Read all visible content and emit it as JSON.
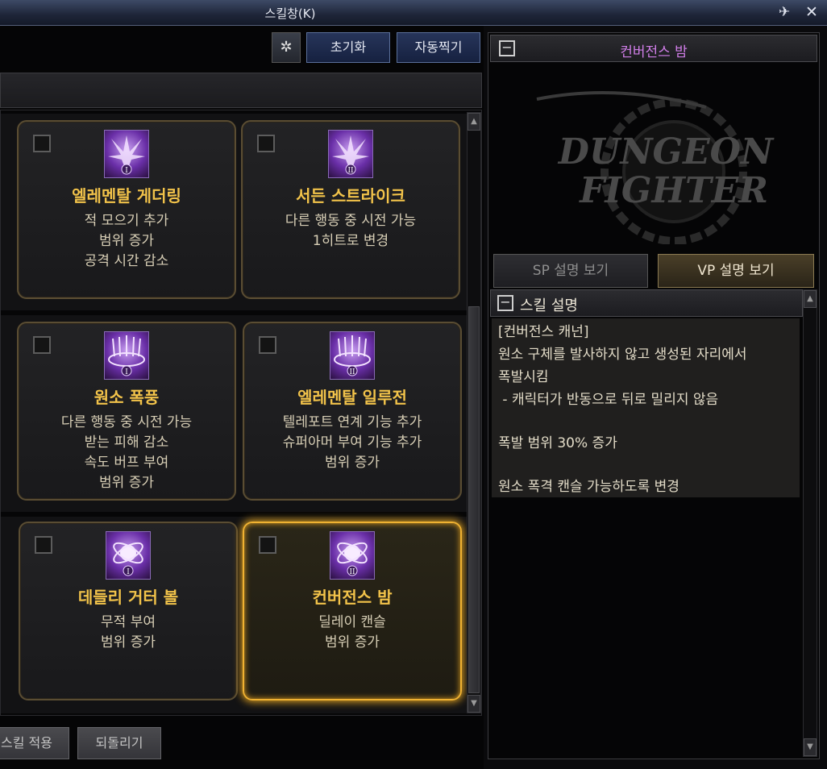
{
  "window": {
    "title": "스킬창(K)",
    "pin_icon": "pin-icon",
    "close_icon": "close-icon"
  },
  "toolbar": {
    "filter_icon": "filter-icon",
    "reset_label": "초기화",
    "auto_label": "자동찍기"
  },
  "skills": [
    {
      "name": "엘레멘탈 게더링",
      "tier": "I",
      "lines": [
        "적 모으기 추가",
        "범위 증가",
        "공격 시간 감소"
      ],
      "selected": false
    },
    {
      "name": "서든 스트라이크",
      "tier": "II",
      "lines": [
        "다른 행동 중 시전 가능",
        "1히트로 변경"
      ],
      "selected": false
    },
    {
      "name": "원소 폭풍",
      "tier": "I",
      "lines": [
        "다른 행동 중 시전 가능",
        "받는 피해 감소",
        "속도 버프 부여",
        "범위 증가"
      ],
      "selected": false
    },
    {
      "name": "엘레멘탈 일루전",
      "tier": "II",
      "lines": [
        "텔레포트 연계 기능 추가",
        "슈퍼아머 부여 기능 추가",
        "범위 증가"
      ],
      "selected": false
    },
    {
      "name": "데들리 거터 볼",
      "tier": "I",
      "lines": [
        "무적 부여",
        "범위 증가"
      ],
      "selected": false
    },
    {
      "name": "컨버전스 밤",
      "tier": "II",
      "lines": [
        "딜레이 캔슬",
        "범위 증가"
      ],
      "selected": true
    }
  ],
  "bottom": {
    "apply_label": "스킬 적용",
    "revert_label": "되돌리기"
  },
  "detail": {
    "title": "컨버전스 밤",
    "logo_text_top": "DUNGEON",
    "logo_text_bottom": "FIGHTER",
    "sp_button": "SP 설명 보기",
    "vp_button": "VP 설명 보기",
    "desc_header": "스킬 설명",
    "desc_lines": [
      "[컨버전스 캐넌]",
      "원소 구체를 발사하지 않고 생성된 자리에서",
      "폭발시킴",
      " - 캐릭터가 반동으로 뒤로 밀리지 않음",
      "",
      "폭발 범위 30% 증가",
      "",
      "원소 폭격 캔슬 가능하도록 변경"
    ]
  },
  "colors": {
    "skill_name": "#f2c34a",
    "selected_border": "#f0b232",
    "detail_title": "#d07ee8",
    "button_blue": "#27355a"
  }
}
